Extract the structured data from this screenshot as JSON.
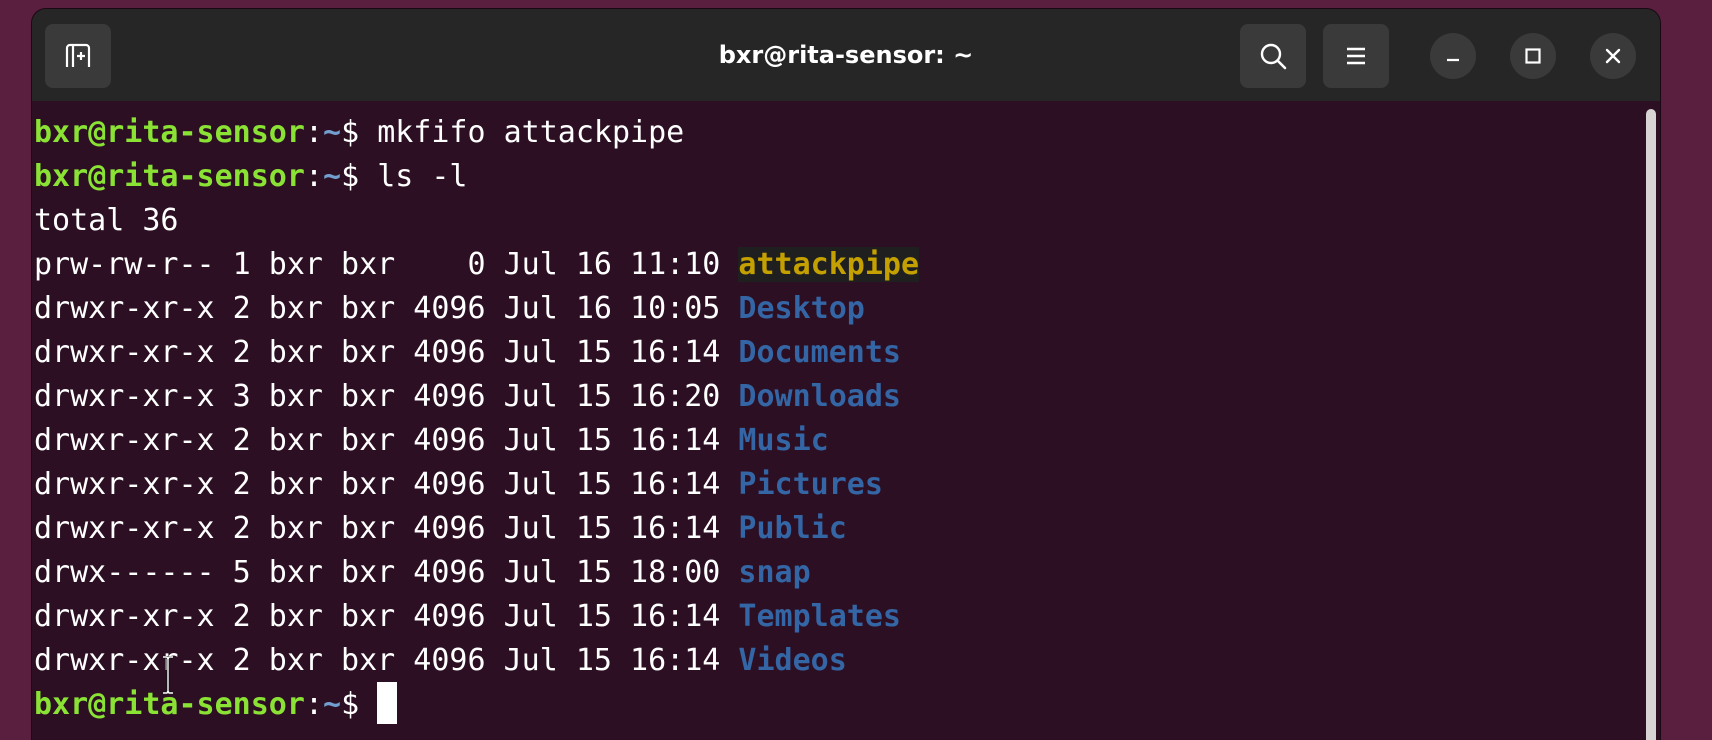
{
  "window": {
    "title": "bxr@rita-sensor: ~"
  },
  "toolbar": {
    "new_tab_icon": "new-tab-icon",
    "search_icon": "search-icon",
    "menu_icon": "hamburger-menu-icon",
    "minimize_icon": "minimize-icon",
    "maximize_icon": "maximize-icon",
    "close_icon": "close-icon"
  },
  "colors": {
    "background": "#2c0f23",
    "prompt_user": "#8ae234",
    "directory": "#3465a4",
    "fifo": "#c4a000",
    "text": "#ffffff"
  },
  "terminal": {
    "prompt_user": "bxr@rita-sensor",
    "prompt_sep": ":",
    "prompt_path": "~",
    "prompt_end": "$ ",
    "commands": [
      "mkfifo attackpipe",
      "ls -l"
    ],
    "total": "total 36",
    "entries": [
      {
        "meta": "prw-rw-r-- 1 bxr bxr    0 Jul 16 11:10 ",
        "name": "attackpipe"
      },
      {
        "meta": "drwxr-xr-x 2 bxr bxr 4096 Jul 16 10:05 ",
        "name": "Desktop"
      },
      {
        "meta": "drwxr-xr-x 2 bxr bxr 4096 Jul 15 16:14 ",
        "name": "Documents"
      },
      {
        "meta": "drwxr-xr-x 3 bxr bxr 4096 Jul 15 16:20 ",
        "name": "Downloads"
      },
      {
        "meta": "drwxr-xr-x 2 bxr bxr 4096 Jul 15 16:14 ",
        "name": "Music"
      },
      {
        "meta": "drwxr-xr-x 2 bxr bxr 4096 Jul 15 16:14 ",
        "name": "Pictures"
      },
      {
        "meta": "drwxr-xr-x 2 bxr bxr 4096 Jul 15 16:14 ",
        "name": "Public"
      },
      {
        "meta": "drwx------ 5 bxr bxr 4096 Jul 15 18:00 ",
        "name": "snap"
      },
      {
        "meta": "drwxr-xr-x 2 bxr bxr 4096 Jul 15 16:14 ",
        "name": "Templates"
      },
      {
        "meta": "drwxr-xr-x 2 bxr bxr 4096 Jul 15 16:14 ",
        "name": "Videos"
      }
    ]
  }
}
